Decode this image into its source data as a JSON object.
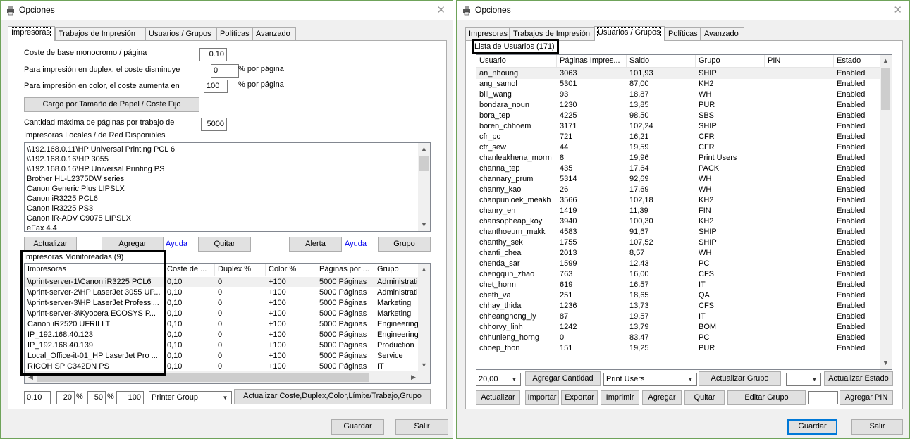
{
  "left": {
    "title": "Opciones",
    "tabs": [
      "Impresoras",
      "Trabajos de Impresión",
      "Usuarios / Grupos",
      "Políticas",
      "Avanzado"
    ],
    "form": {
      "mono_label": "Coste de base monocromo / página",
      "mono_value": "0.10",
      "duplex_label": "Para impresión en duplex, el coste disminuye",
      "duplex_value": "0",
      "duplex_unit": "% por página",
      "color_label": "Para impresión en color, el coste aumenta en",
      "color_value": "100",
      "color_unit": "% por página",
      "paper_button": "Cargo por Tamaño de Papel / Coste Fijo",
      "max_pages_label": "Cantidad máxima de páginas por trabajo de",
      "max_pages_value": "5000"
    },
    "local_printers_label": "Impresoras Locales / de Red Disponibles",
    "local_printers": [
      "\\\\192.168.0.11\\HP Universal Printing PCL 6",
      "\\\\192.168.0.16\\HP 3055",
      "\\\\192.168.0.16\\HP Universal Printing PS",
      "Brother HL-L2375DW series",
      "Canon Generic Plus LIPSLX",
      "Canon iR3225 PCL6",
      "Canon iR3225 PS3",
      "Canon iR-ADV C9075 LIPSLX",
      "eFax 4.4"
    ],
    "buttons": {
      "actualizar": "Actualizar",
      "agregar": "Agregar",
      "ayuda": "Ayuda",
      "quitar": "Quitar",
      "alerta": "Alerta",
      "ayuda2": "Ayuda",
      "grupo": "Grupo"
    },
    "monitored_label": "Impresoras Monitoreadas (9)",
    "monitored_columns": [
      "Impresoras",
      "Coste de ...",
      "Duplex %",
      "Color %",
      "Páginas por ...",
      "Grupo"
    ],
    "monitored_rows": [
      [
        "\\\\print-server-1\\Canon iR3225 PCL6",
        "0,10",
        "0",
        "+100",
        "5000 Páginas",
        "Administration"
      ],
      [
        "\\\\print-server-2\\HP LaserJet 3055 UP...",
        "0,10",
        "0",
        "+100",
        "5000 Páginas",
        "Administration"
      ],
      [
        "\\\\print-server-3\\HP LaserJet Professi...",
        "0,10",
        "0",
        "+100",
        "5000 Páginas",
        "Marketing"
      ],
      [
        "\\\\print-server-3\\Kyocera ECOSYS P...",
        "0,10",
        "0",
        "+100",
        "5000 Páginas",
        "Marketing"
      ],
      [
        "Canon iR2520 UFRII LT",
        "0,10",
        "0",
        "+100",
        "5000 Páginas",
        "Engineering"
      ],
      [
        "IP_192.168.40.123",
        "0,10",
        "0",
        "+100",
        "5000 Páginas",
        "Engineering"
      ],
      [
        "IP_192.168.40.139",
        "0,10",
        "0",
        "+100",
        "5000 Páginas",
        "Production"
      ],
      [
        "Local_Office-it-01_HP LaserJet Pro ...",
        "0,10",
        "0",
        "+100",
        "5000 Páginas",
        "Service"
      ],
      [
        "RICOH SP C342DN PS",
        "0,10",
        "0",
        "+100",
        "5000 Páginas",
        "IT"
      ]
    ],
    "bottom": {
      "cost": "0.10",
      "duplex": "20",
      "pct1": "%",
      "color": "50",
      "pct2": "%",
      "pages": "100",
      "group_select": "Printer Group",
      "update_button": "Actualizar Coste,Duplex,Color,Límite/Trabajo,Grupo"
    },
    "guardar": "Guardar",
    "salir": "Salir"
  },
  "right": {
    "title": "Opciones",
    "tabs": [
      "Impresoras",
      "Trabajos de Impresión",
      "Usuarios / Grupos",
      "Políticas",
      "Avanzado"
    ],
    "users_label": "Lista de Usuarios (171)",
    "columns": [
      "Usuario",
      "Páginas Impres...",
      "Saldo",
      "Grupo",
      "PIN",
      "Estado"
    ],
    "rows": [
      [
        "an_nhoung",
        "3063",
        "101,93",
        "SHIP",
        "",
        "Enabled"
      ],
      [
        "ang_samol",
        "5301",
        "87,00",
        "KH2",
        "",
        "Enabled"
      ],
      [
        "bill_wang",
        "93",
        "18,87",
        "WH",
        "",
        "Enabled"
      ],
      [
        "bondara_noun",
        "1230",
        "13,85",
        "PUR",
        "",
        "Enabled"
      ],
      [
        "bora_tep",
        "4225",
        "98,50",
        "SBS",
        "",
        "Enabled"
      ],
      [
        "boren_chhoem",
        "3171",
        "102,24",
        "SHIP",
        "",
        "Enabled"
      ],
      [
        "cfr_pc",
        "721",
        "16,21",
        "CFR",
        "",
        "Enabled"
      ],
      [
        "cfr_sew",
        "44",
        "19,59",
        "CFR",
        "",
        "Enabled"
      ],
      [
        "chanleakhena_morm",
        "8",
        "19,96",
        "Print Users",
        "",
        "Enabled"
      ],
      [
        "channa_tep",
        "435",
        "17,64",
        "PACK",
        "",
        "Enabled"
      ],
      [
        "channary_prum",
        "5314",
        "92,69",
        "WH",
        "",
        "Enabled"
      ],
      [
        "channy_kao",
        "26",
        "17,69",
        "WH",
        "",
        "Enabled"
      ],
      [
        "chanpunloek_meakh",
        "3566",
        "102,18",
        "KH2",
        "",
        "Enabled"
      ],
      [
        "chanry_en",
        "1419",
        "11,39",
        "FIN",
        "",
        "Enabled"
      ],
      [
        "chansopheap_koy",
        "3940",
        "100,30",
        "KH2",
        "",
        "Enabled"
      ],
      [
        "chanthoeurn_makk",
        "4583",
        "91,67",
        "SHIP",
        "",
        "Enabled"
      ],
      [
        "chanthy_sek",
        "1755",
        "107,52",
        "SHIP",
        "",
        "Enabled"
      ],
      [
        "chanti_chea",
        "2013",
        "8,57",
        "WH",
        "",
        "Enabled"
      ],
      [
        "chenda_sar",
        "1599",
        "12,43",
        "PC",
        "",
        "Enabled"
      ],
      [
        "chengqun_zhao",
        "763",
        "16,00",
        "CFS",
        "",
        "Enabled"
      ],
      [
        "chet_horm",
        "619",
        "16,57",
        "IT",
        "",
        "Enabled"
      ],
      [
        "cheth_va",
        "251",
        "18,65",
        "QA",
        "",
        "Enabled"
      ],
      [
        "chhay_thida",
        "1236",
        "13,73",
        "CFS",
        "",
        "Enabled"
      ],
      [
        "chheanghong_ly",
        "87",
        "19,57",
        "IT",
        "",
        "Enabled"
      ],
      [
        "chhorvy_linh",
        "1242",
        "13,79",
        "BOM",
        "",
        "Enabled"
      ],
      [
        "chhunleng_horng",
        "0",
        "83,47",
        "PC",
        "",
        "Enabled"
      ],
      [
        "choep_thon",
        "151",
        "19,25",
        "PUR",
        "",
        "Enabled"
      ]
    ],
    "controls": {
      "amount": "20,00",
      "add_amount": "Agregar Cantidad",
      "group_select": "Print Users",
      "update_group": "Actualizar Grupo",
      "status_select": "",
      "update_status": "Actualizar Estado",
      "actualizar": "Actualizar",
      "importar": "Importar",
      "exportar": "Exportar",
      "imprimir": "Imprimir",
      "agregar": "Agregar",
      "quitar": "Quitar",
      "editar_grupo": "Editar Grupo",
      "pin_value": "",
      "agregar_pin": "Agregar PIN"
    },
    "guardar": "Guardar",
    "salir": "Salir"
  },
  "icons": {
    "app": "printer-app-icon",
    "close": "close-icon",
    "scroll_up": "chevron-up-icon",
    "scroll_down": "chevron-down-icon",
    "scroll_left": "chevron-left-icon",
    "scroll_right": "chevron-right-icon",
    "dropdown": "chevron-down-icon"
  },
  "colors": {
    "window_border": "#6fa35a",
    "link": "#0000ee",
    "focus": "#0078d7"
  }
}
